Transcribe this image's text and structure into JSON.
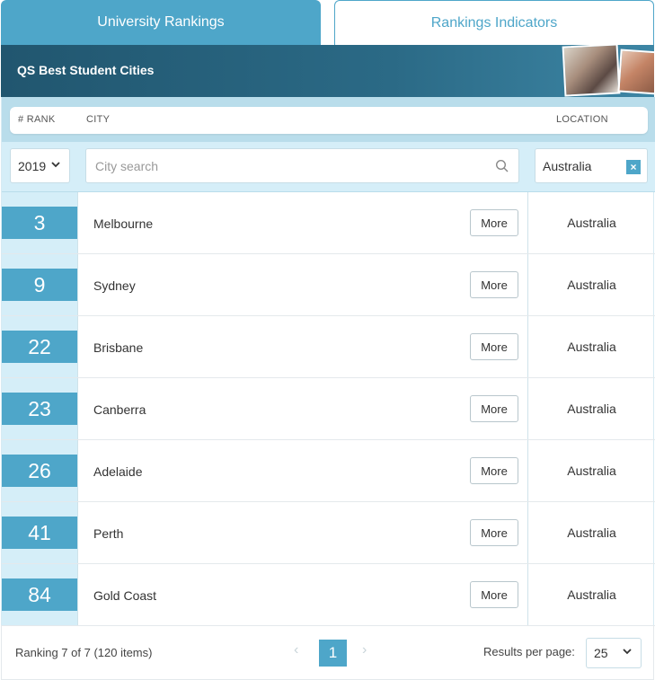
{
  "tabs": {
    "active": "University Rankings",
    "inactive": "Rankings Indicators"
  },
  "banner": {
    "title": "QS Best Student Cities"
  },
  "table": {
    "headers": {
      "rank": "# RANK",
      "city": "CITY",
      "location": "LOCATION"
    },
    "filters": {
      "year": "2019",
      "city_placeholder": "City search",
      "location": "Australia",
      "clear": "×"
    },
    "more_label": "More",
    "rows": [
      {
        "rank": "3",
        "city": "Melbourne",
        "location": "Australia"
      },
      {
        "rank": "9",
        "city": "Sydney",
        "location": "Australia"
      },
      {
        "rank": "22",
        "city": "Brisbane",
        "location": "Australia"
      },
      {
        "rank": "23",
        "city": "Canberra",
        "location": "Australia"
      },
      {
        "rank": "26",
        "city": "Adelaide",
        "location": "Australia"
      },
      {
        "rank": "41",
        "city": "Perth",
        "location": "Australia"
      },
      {
        "rank": "84",
        "city": "Gold Coast",
        "location": "Australia"
      }
    ]
  },
  "footer": {
    "ranking_info": "Ranking 7 of 7 (120 items)",
    "prev": "‹",
    "page": "1",
    "next": "›",
    "results_per_page_label": "Results per page:",
    "results_per_page_value": "25"
  },
  "colors": {
    "accent": "#4ea6c9",
    "banner_dark": "#21566f",
    "rank_column": "#d5eef8"
  }
}
